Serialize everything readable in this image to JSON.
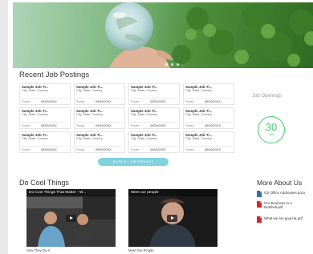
{
  "hero": {
    "slide_count": 3,
    "active_slide": 1
  },
  "recent": {
    "title": "Recent Job Postings",
    "jobs": [
      {
        "title": "Sample Job Ti...",
        "location": "City, State, Country",
        "posted_label": "Posted",
        "date": "09/09/20XX"
      },
      {
        "title": "Sample Job Ti...",
        "location": "City, State, Country",
        "posted_label": "Posted",
        "date": "09/09/20XX"
      },
      {
        "title": "Sample Job Ti...",
        "location": "City, State, Country",
        "posted_label": "Posted",
        "date": "09/09/20XX"
      },
      {
        "title": "Sample Job Ti...",
        "location": "City, State, Country",
        "posted_label": "Posted",
        "date": "09/09/20XX"
      },
      {
        "title": "Sample Job Ti...",
        "location": "City, State, Country",
        "posted_label": "Posted",
        "date": "09/09/20XX"
      },
      {
        "title": "Sample Job Ti...",
        "location": "City, State, Country",
        "posted_label": "Posted",
        "date": "09/09/20XX"
      },
      {
        "title": "Sample Job Ti...",
        "location": "City, State, Country",
        "posted_label": "Posted",
        "date": "09/09/20XX"
      },
      {
        "title": "Sample Job Ti...",
        "location": "City, State, Country",
        "posted_label": "Posted",
        "date": "09/09/20XX"
      },
      {
        "title": "Sample Job Ti...",
        "location": "City, State, Country",
        "posted_label": "Posted",
        "date": "09/09/20XX"
      },
      {
        "title": "Sample Job Ti...",
        "location": "City, State, Country",
        "posted_label": "Posted",
        "date": "09/09/20XX"
      },
      {
        "title": "Sample Job Ti...",
        "location": "City, State, Country",
        "posted_label": "Posted",
        "date": "09/09/20XX"
      },
      {
        "title": "Sample Job Ti...",
        "location": "City, State, Country",
        "posted_label": "Posted",
        "date": "09/09/20XX"
      }
    ],
    "show_all_label": "SHOW ALL JOB OPENINGS"
  },
  "openings": {
    "label": "Job Openings",
    "count": "30",
    "unit": "Jobs",
    "color": "#3fcf6a"
  },
  "cool": {
    "title": "Do Cool Things",
    "videos": [
      {
        "title": "Do Cool Things That Matter - W...",
        "caption": "How They Do It",
        "icon": "play-icon"
      },
      {
        "title": "Meet our people",
        "caption": "Meet Our People",
        "icon": "play-icon"
      }
    ]
  },
  "about": {
    "title": "More About Us",
    "docs": [
      {
        "label": "GS Office Addresses.docx",
        "icon": "word-doc-icon",
        "color": "#2f6fb5"
      },
      {
        "label": "Our Business in a Nutshell.pdf",
        "icon": "pdf-icon",
        "color": "#d9252b"
      },
      {
        "label": "What we are good at.pdf",
        "icon": "pdf-icon",
        "color": "#d9252b"
      }
    ]
  }
}
